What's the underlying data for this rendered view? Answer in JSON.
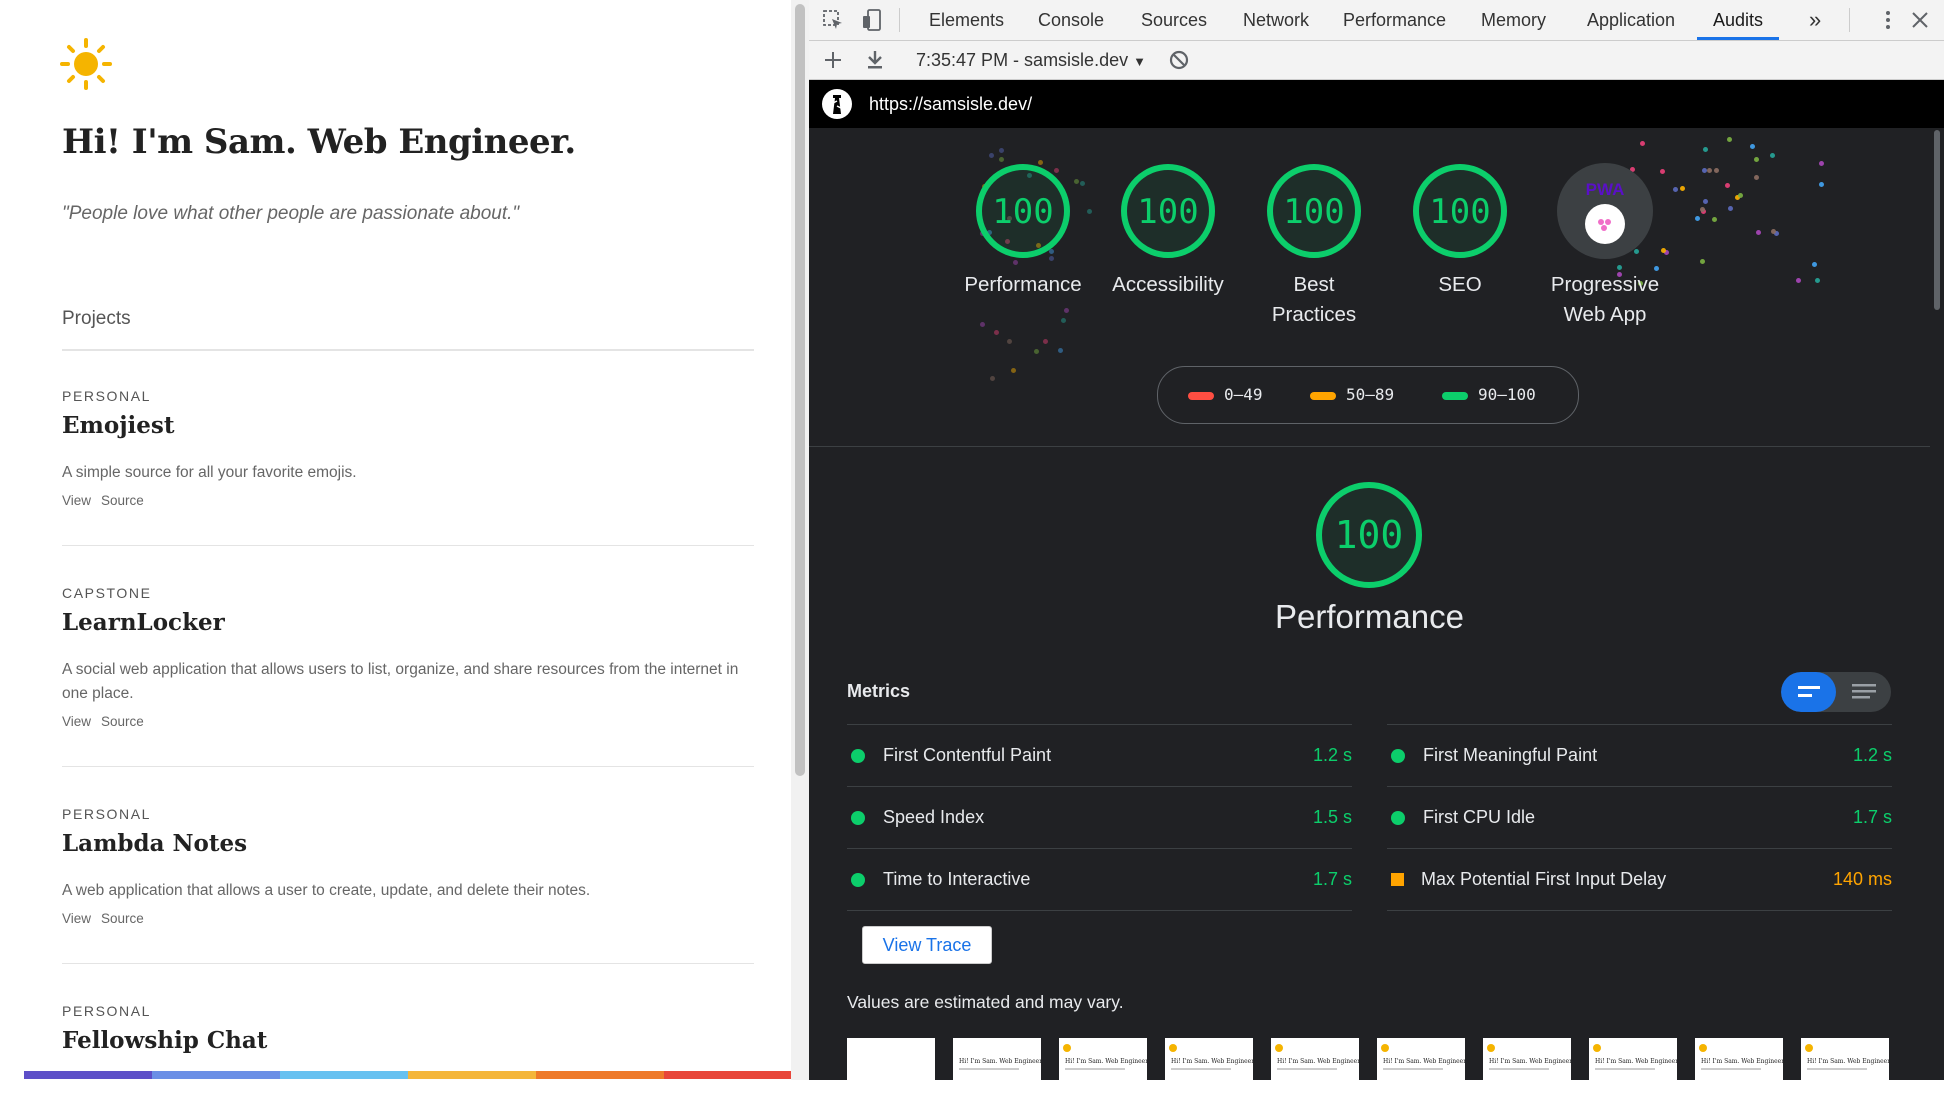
{
  "site": {
    "heading": "Hi! I'm Sam. Web Engineer.",
    "quote": "\"People love what other people are passionate about.\"",
    "section_title": "Projects",
    "projects": [
      {
        "tag": "PERSONAL",
        "name": "Emojiest",
        "desc": "A simple source for all your favorite emojis.",
        "view": "View",
        "source": "Source"
      },
      {
        "tag": "CAPSTONE",
        "name": "LearnLocker",
        "desc": "A social web application that allows users to list, organize, and share resources from the internet in one place.",
        "view": "View",
        "source": "Source"
      },
      {
        "tag": "PERSONAL",
        "name": "Lambda Notes",
        "desc": "A web application that allows a user to create, update, and delete their notes.",
        "view": "View",
        "source": "Source"
      },
      {
        "tag": "PERSONAL",
        "name": "Fellowship Chat"
      }
    ],
    "color_bar": [
      "#5d4fc8",
      "#6b8fe6",
      "#67c1f0",
      "#f4b63b",
      "#ee7a2a",
      "#e8463a"
    ]
  },
  "devtools": {
    "tabs": [
      "Elements",
      "Console",
      "Sources",
      "Network",
      "Performance",
      "Memory",
      "Application",
      "Audits"
    ],
    "active_tab": "Audits",
    "more_tabs": "»",
    "report_label": "7:35:47 PM - samsisle.dev",
    "url": "https://samsisle.dev/"
  },
  "audit": {
    "categories": [
      {
        "label": "Performance",
        "score": "100"
      },
      {
        "label": "Accessibility",
        "score": "100"
      },
      {
        "label": "Best Practices",
        "score": "100"
      },
      {
        "label": "SEO",
        "score": "100"
      },
      {
        "label": "Progressive Web App",
        "badge": "PWA"
      }
    ],
    "legend": [
      {
        "range": "0–49",
        "color": "#ff4e42"
      },
      {
        "range": "50–89",
        "color": "#ffa400"
      },
      {
        "range": "90–100",
        "color": "#0cce6b"
      }
    ],
    "performance_score": "100",
    "performance_title": "Performance",
    "metrics_heading": "Metrics",
    "metrics": [
      {
        "name": "First Contentful Paint",
        "value": "1.2 s",
        "status": "pass"
      },
      {
        "name": "First Meaningful Paint",
        "value": "1.2 s",
        "status": "pass"
      },
      {
        "name": "Speed Index",
        "value": "1.5 s",
        "status": "pass"
      },
      {
        "name": "First CPU Idle",
        "value": "1.7 s",
        "status": "pass"
      },
      {
        "name": "Time to Interactive",
        "value": "1.7 s",
        "status": "pass"
      },
      {
        "name": "Max Potential First Input Delay",
        "value": "140 ms",
        "status": "average"
      }
    ],
    "view_trace": "View Trace",
    "estimate_note": "Values are estimated and may vary.",
    "filmstrip_caption": "Hi! I'm Sam. Web Engineer.",
    "pass_color": "#0cce6b",
    "average_color": "#ffa400"
  }
}
